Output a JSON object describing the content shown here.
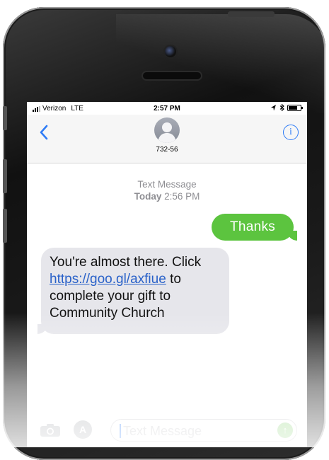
{
  "status_bar": {
    "carrier": "Verizon",
    "network": "LTE",
    "time": "2:57 PM"
  },
  "header": {
    "contact": "732-56"
  },
  "conversation": {
    "label": "Text Message",
    "day": "Today",
    "time": "2:56 PM",
    "messages": [
      {
        "direction": "outgoing",
        "text": "Thanks"
      },
      {
        "direction": "incoming",
        "text_before": "You're almost there. Click",
        "link": "https://goo.gl/axfiue",
        "text_after": "to complete your gift to Community Church"
      }
    ]
  },
  "composer": {
    "placeholder": "Text Message"
  },
  "colors": {
    "accent": "#2f7cf6",
    "outgoing_bubble": "#5cc43f",
    "incoming_bubble": "#e6e6eb",
    "link": "#2a62c9"
  },
  "icons": [
    "back-chevron-icon",
    "info-icon",
    "avatar-icon",
    "camera-icon",
    "app-store-icon",
    "send-icon",
    "signal-icon",
    "location-icon",
    "bluetooth-icon",
    "battery-icon"
  ]
}
